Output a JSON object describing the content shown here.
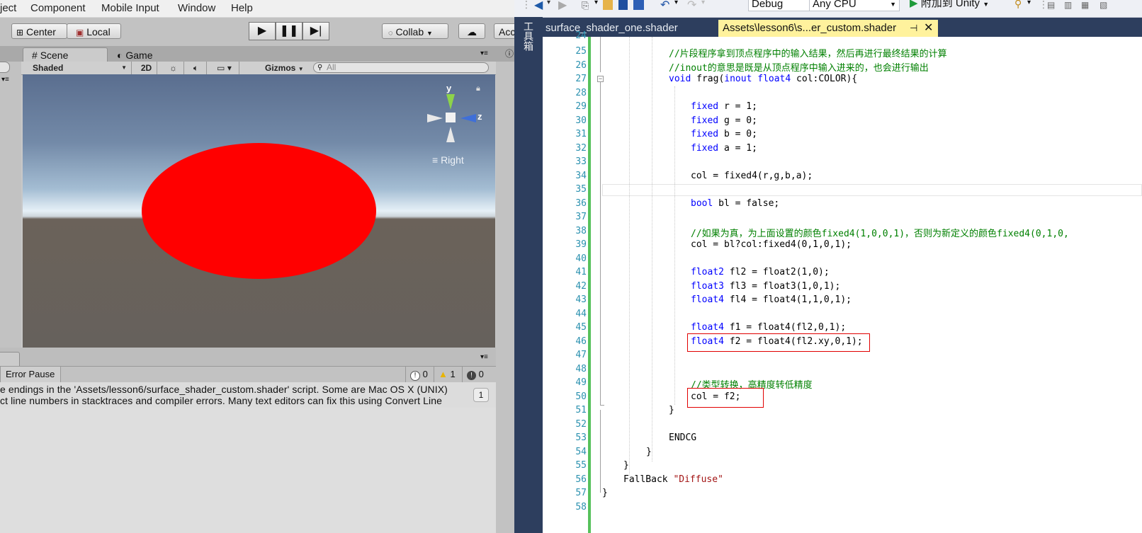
{
  "unity": {
    "menu": [
      "ject",
      "Component",
      "Mobile Input",
      "Window",
      "Help"
    ],
    "toolbar": {
      "pivot": "Center",
      "space": "Local",
      "collab": "Collab",
      "account": "Acc"
    },
    "tabs": {
      "scene": "Scene",
      "game": "Game"
    },
    "scene_toolbar": {
      "shading": "Shaded",
      "mode2d": "2D",
      "gizmos": "Gizmos",
      "search_placeholder": "All"
    },
    "gizmo": {
      "y": "y",
      "z": "z",
      "view": "Right"
    },
    "console": {
      "error_pause": "Error Pause",
      "error_count": "0",
      "warning_count": "1",
      "info_count": "0",
      "badge": "1",
      "line1": "e endings in the 'Assets/lesson6/surface_shader_custom.shader' script. Some are Mac OS X (UNIX)",
      "line2": "ct line numbers in stacktraces and compiler errors. Many text editors can fix this using Convert Line"
    }
  },
  "vs": {
    "toolbar": {
      "config": "Debug",
      "platform": "Any CPU",
      "attach": "附加到 Unity"
    },
    "left_panel": "工具箱",
    "tabs": [
      {
        "label": "surface_shader_one.shader"
      },
      {
        "label": "Assets\\lesson6\\s...er_custom.shader"
      }
    ],
    "colors": {
      "accent_tab": "#fff29d",
      "line_number": "#2b91af",
      "keyword": "#0000ff",
      "comment": "#008000",
      "string": "#a31515",
      "highlight_box": "#e10000"
    },
    "code": {
      "l24": "",
      "l25": "//片段程序拿到顶点程序中的输入结果，然后再进行最终结果的计算",
      "l26": "//inout的意思是既是从顶点程序中输入进来的，也会进行输出",
      "l27a": "void",
      "l27b": " frag(",
      "l27c": "inout",
      "l27d": " ",
      "l27e": "float4",
      "l27f": " col:COLOR){",
      "l29a": "fixed",
      "l29b": " r = 1;",
      "l30a": "fixed",
      "l30b": " g = 0;",
      "l31a": "fixed",
      "l31b": " b = 0;",
      "l32a": "fixed",
      "l32b": " a = 1;",
      "l34": "col = fixed4(r,g,b,a);",
      "l36a": "bool",
      "l36b": " bl = false;",
      "l38": "//如果为真，为上面设置的颜色fixed4(1,0,0,1)，否则为新定义的颜色fixed4(0,1,0,",
      "l39": "col = bl?col:fixed4(0,1,0,1);",
      "l41a": "float2",
      "l41b": " fl2 = float2(1,0);",
      "l42a": "float3",
      "l42b": " fl3 = float3(1,0,1);",
      "l43a": "float4",
      "l43b": " fl4 = float4(1,1,0,1);",
      "l45a": "float4",
      "l45b": " f1 = float4(fl2,0,1);",
      "l46a": "float4",
      "l46b": " f2 = float4(fl2.xy,0,1);",
      "l49": "//类型转换，高精度转低精度",
      "l50": "col = f2;",
      "l51": "}",
      "l53": "ENDCG",
      "l54": "}",
      "l55": "}",
      "l56a": "FallBack ",
      "l56b": "\"Diffuse\"",
      "l57": "}"
    }
  }
}
